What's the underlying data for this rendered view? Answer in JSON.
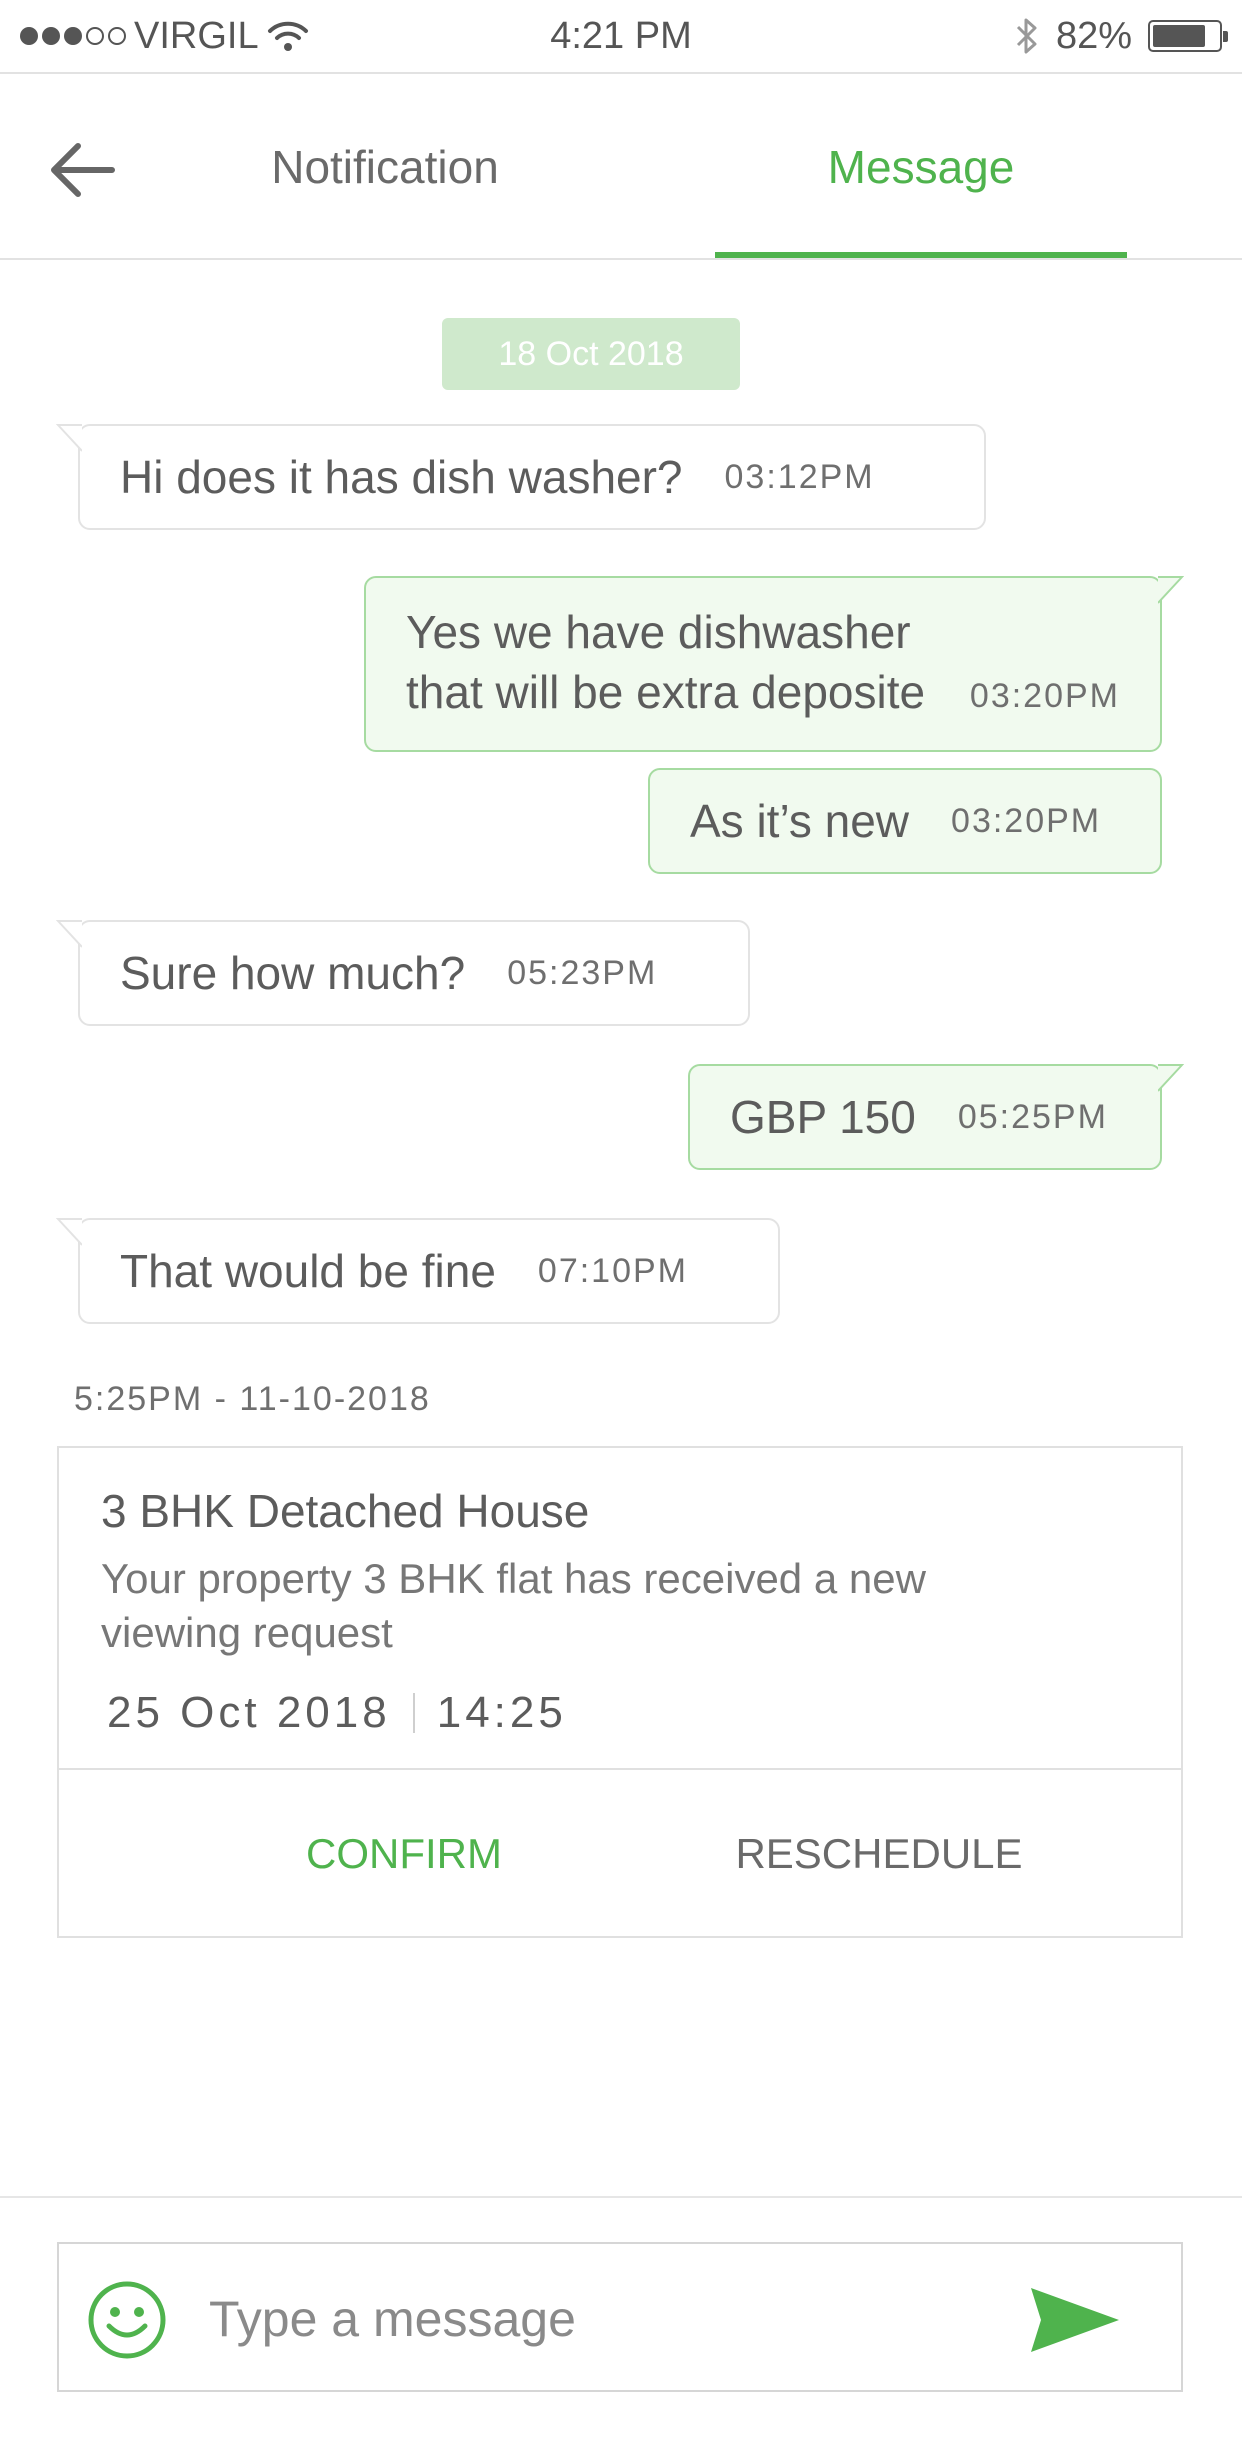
{
  "status_bar": {
    "carrier": "VIRGIL",
    "time": "4:21 PM",
    "battery": "82%",
    "battery_level": 0.82
  },
  "header": {
    "tabs": [
      {
        "label": "Notification",
        "active": false
      },
      {
        "label": "Message",
        "active": true
      }
    ]
  },
  "chat": {
    "date_chip": "18 Oct 2018",
    "messages": [
      {
        "direction": "incoming",
        "text": "Hi does it has dish washer?",
        "time": "03:12PM"
      },
      {
        "direction": "outgoing",
        "text": "Yes we have dishwasher that will be extra deposite",
        "time": "03:20PM"
      },
      {
        "direction": "outgoing",
        "text": "As it’s new",
        "time": "03:20PM"
      },
      {
        "direction": "incoming",
        "text": "Sure how much?",
        "time": "05:23PM"
      },
      {
        "direction": "outgoing",
        "text": "GBP 150",
        "time": "05:25PM"
      },
      {
        "direction": "incoming",
        "text": "That would be fine",
        "time": "07:10PM"
      }
    ]
  },
  "viewing_card": {
    "timestamp": "5:25PM - 11-10-2018",
    "title": "3 BHK Detached House",
    "description": "Your property 3 BHK flat has received a new viewing request",
    "date": "25 Oct 2018",
    "time": "14:25",
    "confirm_label": "CONFIRM",
    "reschedule_label": "RESCHEDULE"
  },
  "composer": {
    "placeholder": "Type a message",
    "value": ""
  },
  "colors": {
    "accent": "#4fb34d",
    "outgoing_bubble_bg": "#f1faef",
    "outgoing_bubble_border": "#a6dba1",
    "incoming_bubble_border": "#e3e3e3",
    "date_chip_bg": "#cfe9cc"
  },
  "icons": [
    "back-arrow-icon",
    "wifi-icon",
    "bluetooth-icon",
    "battery-icon",
    "smiley-icon",
    "send-icon"
  ]
}
